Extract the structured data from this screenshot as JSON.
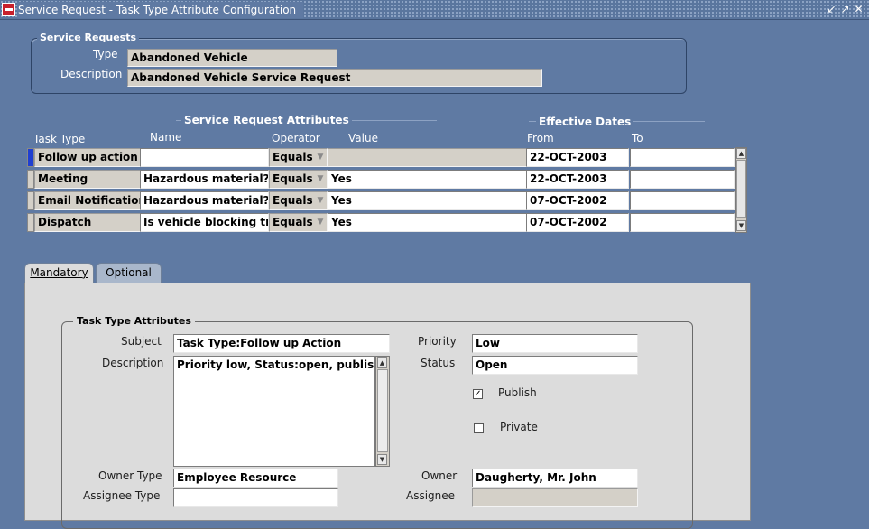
{
  "window": {
    "title": "Service Request - Task Type Attribute Configuration",
    "app_icon": "oracle-logo-icon",
    "controls": [
      "minimize-icon",
      "maximize-icon",
      "close-icon"
    ]
  },
  "service_requests": {
    "section_title": "Service Requests",
    "type_label": "Type",
    "type_value": "Abandoned Vehicle",
    "description_label": "Description",
    "description_value": "Abandoned Vehicle Service Request"
  },
  "attributes_table": {
    "group_title": "Service Request Attributes",
    "dates_group_title": "Effective Dates",
    "headers": {
      "task_type": "Task Type",
      "name": "Name",
      "operator": "Operator",
      "value": "Value",
      "from": "From",
      "to": "To"
    },
    "rows": [
      {
        "task_type": "Follow up action",
        "name": "",
        "operator": "Equals",
        "value": "",
        "from": "22-OCT-2003",
        "to": "",
        "active": true
      },
      {
        "task_type": "Meeting",
        "name": "Hazardous material?",
        "operator": "Equals",
        "value": "Yes",
        "from": "22-OCT-2003",
        "to": ""
      },
      {
        "task_type": "Email Notification",
        "name": "Hazardous material?",
        "operator": "Equals",
        "value": "Yes",
        "from": "07-OCT-2002",
        "to": ""
      },
      {
        "task_type": "Dispatch",
        "name": "Is vehicle blocking tra",
        "operator": "Equals",
        "value": "Yes",
        "from": "07-OCT-2002",
        "to": ""
      }
    ]
  },
  "tabs": [
    {
      "label": "Mandatory",
      "active": true
    },
    {
      "label": "Optional",
      "active": false
    }
  ],
  "task_type_attributes": {
    "section_title": "Task Type Attributes",
    "subject_label": "Subject",
    "subject_value": "Task Type:Follow up Action",
    "description_label": "Description",
    "description_value": "Priority low, Status:open, publish",
    "priority_label": "Priority",
    "priority_value": "Low",
    "status_label": "Status",
    "status_value": "Open",
    "publish_label": "Publish",
    "publish_checked": true,
    "private_label": "Private",
    "private_checked": false,
    "owner_type_label": "Owner Type",
    "owner_type_value": "Employee Resource",
    "owner_label": "Owner",
    "owner_value": "Daugherty, Mr. John",
    "assignee_type_label": "Assignee Type",
    "assignee_type_value": "",
    "assignee_label": "Assignee",
    "assignee_value": ""
  }
}
